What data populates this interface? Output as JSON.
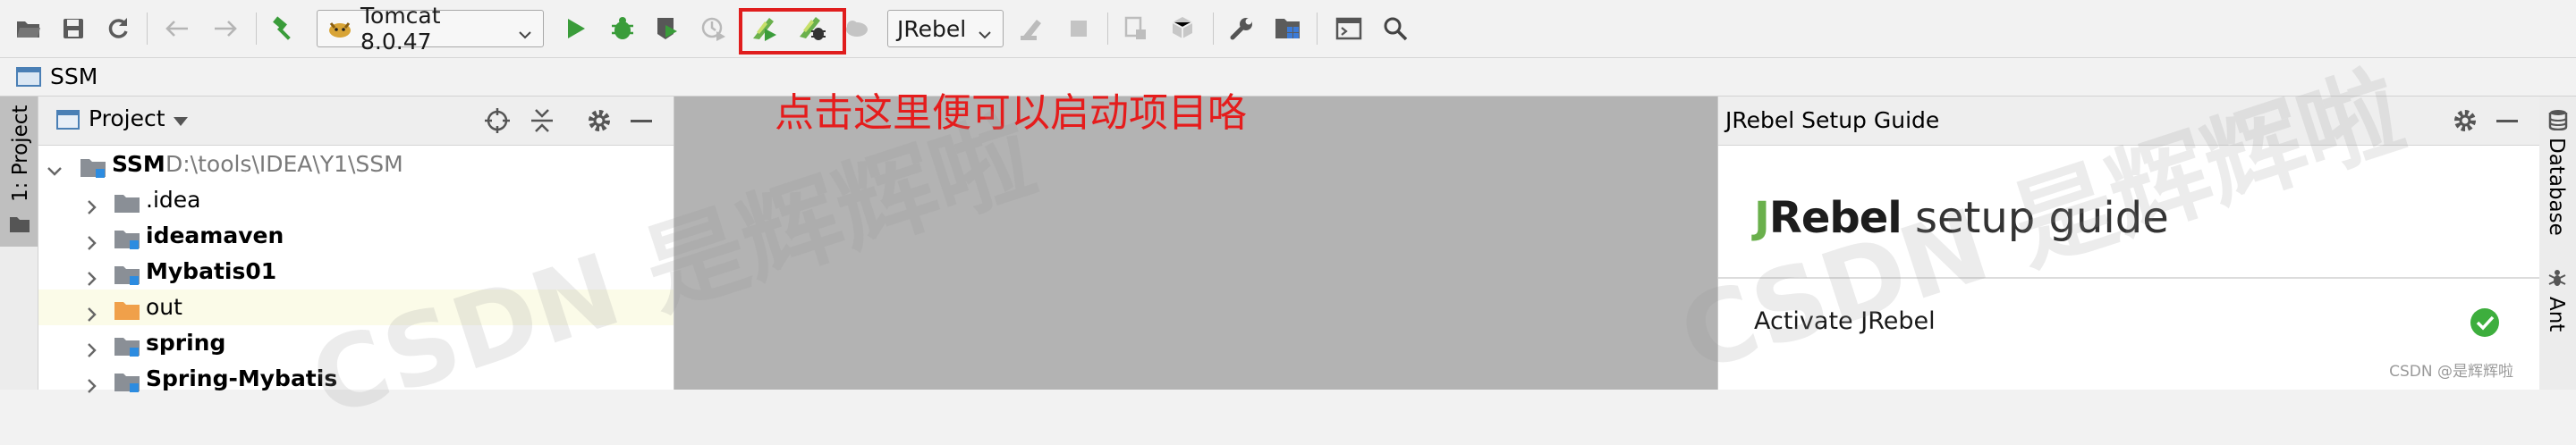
{
  "toolbar": {
    "run_config": "Tomcat 8.0.47",
    "jrebel_config": "JRebel"
  },
  "breadcrumb": {
    "project": "SSM"
  },
  "left_stripe": {
    "project_tab": "1: Project"
  },
  "project_panel": {
    "title": "Project",
    "root": {
      "name": "SSM",
      "path": "D:\\tools\\IDEA\\Y1\\SSM"
    },
    "items": [
      {
        "label": ".idea",
        "bold": false,
        "type": "folder"
      },
      {
        "label": "ideamaven",
        "bold": true,
        "type": "module"
      },
      {
        "label": "Mybatis01",
        "bold": true,
        "type": "module"
      },
      {
        "label": "out",
        "bold": false,
        "type": "excluded"
      },
      {
        "label": "spring",
        "bold": true,
        "type": "module"
      },
      {
        "label": "Spring-Mybatis",
        "bold": true,
        "type": "module"
      }
    ]
  },
  "annotation": "点击这里便可以启动项目咯",
  "jrebel_panel": {
    "title": "JRebel Setup Guide",
    "logo_brand_j": "J",
    "logo_brand_rest": "Rebel",
    "logo_suffix": "setup guide",
    "activate_label": "Activate JRebel"
  },
  "right_stripe": {
    "database_tab": "Database",
    "ant_tab": "Ant"
  },
  "watermark": {
    "left": "CSDN 是辉辉啦",
    "right": "CSDN 是辉辉啦",
    "credit": "CSDN @是辉辉啦"
  },
  "colors": {
    "highlight_border": "#e01d1d",
    "annotation_text": "#e51c1c",
    "run_green": "#3a9c3a",
    "jrebel_green": "#6ab04c"
  }
}
